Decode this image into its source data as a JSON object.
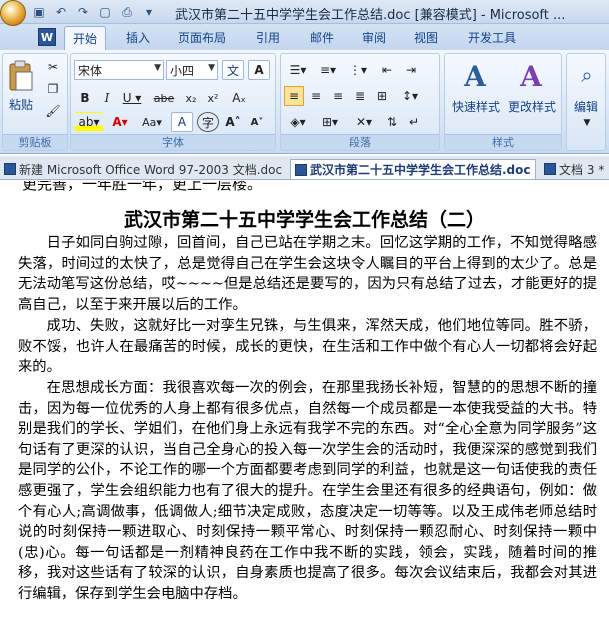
{
  "window": {
    "title": "武汉市第二十五中学学生会工作总结.doc [兼容模式] - Microsoft ..."
  },
  "ribbon_tabs": [
    "开始",
    "插入",
    "页面布局",
    "引用",
    "邮件",
    "审阅",
    "视图",
    "开发工具"
  ],
  "ribbon": {
    "clipboard": {
      "paste_label": "粘贴",
      "group_label": "剪贴板"
    },
    "font": {
      "font_name": "宋体",
      "font_size": "小四",
      "group_label": "字体"
    },
    "paragraph": {
      "group_label": "段落"
    },
    "styles": {
      "quick_styles_label": "快速样式",
      "change_styles_label": "更改样式",
      "group_label": "样式"
    },
    "editing": {
      "edit_label": "编辑"
    }
  },
  "doc_tabs": [
    {
      "label": "新建 Microsoft Office Word 97-2003 文档.doc",
      "active": false
    },
    {
      "label": "武汉市第二十五中学学生会工作总结.doc",
      "active": true
    },
    {
      "label": "文档 3 *",
      "active": false
    }
  ],
  "document": {
    "cut_line": "更完善，一年胜一年，更上一层楼。",
    "heading": "武汉市第二十五中学学生会工作总结（二）",
    "paragraphs": [
      "日子如同白驹过隙，回首间，自己已站在学期之末。回忆这学期的工作，不知觉得略感失落，时间过的太快了，总是觉得自己在学生会这块令人瞩目的平台上得到的太少了。总是无法动笔写这份总结，哎~~~~但是总结还是要写的，因为只有总结了过去，才能更好的提高自己，以至于来开展以后的工作。",
      "成功、失败，这就好比一对孪生兄铢，与生俱来，浑然天成，他们地位等同。胜不骄，败不馁，也许人在最痛苦的时候，成长的更快，在生活和工作中做个有心人一切都将会好起来的。",
      "在思想成长方面：我很喜欢每一次的例会，在那里我扬长补短，智慧的的思想不断的撞击，因为每一位优秀的人身上都有很多优点，自然每一个成员都是一本使我受益的大书。特别是我们的学长、学姐们，在他们身上永远有我学不完的东西。对“全心全意为同学服务”这句话有了更深的认识，当自己全身心的投入每一次学生会的活动时，我便深深的感觉到我们是同学的公仆，不论工作的哪一个方面都要考虑到同学的利益，也就是这一句话使我的责任感更强了，学生会组织能力也有了很大的提升。在学生会里还有很多的经典语句，例如：做个有心人;高调做事，低调做人;细节决定成败，态度决定一切等等。以及王成伟老师总结时说的时刻保持一颗进取心、时刻保持一颗平常心、时刻保持一颗忍耐心、时刻保持一颗中(忠)心。每一句话都是一剂精神良药在工作中我不断的实践，领会，实践，随着时间的推移，我对这些话有了较深的认识，自身素质也提高了很多。每次会议结束后，我都会对其进行编辑，保存到学生会电脑中存档。"
    ]
  }
}
